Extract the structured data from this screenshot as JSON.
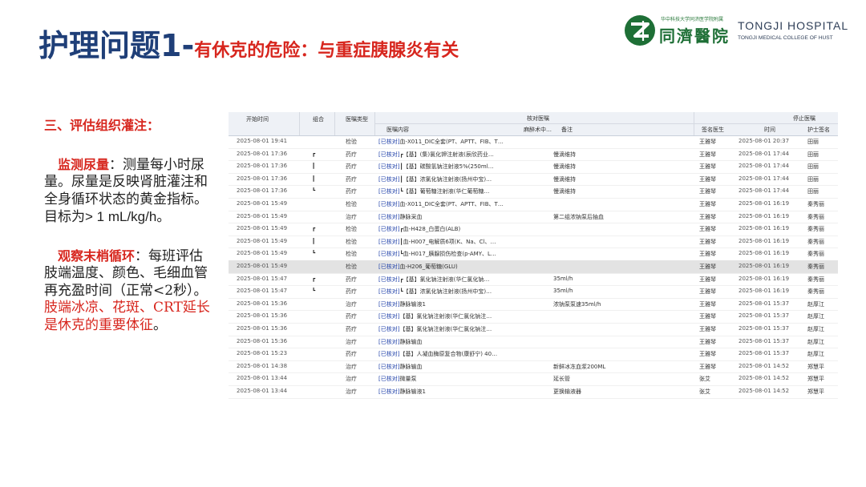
{
  "title": {
    "main": "护理问题1-",
    "sub": "有休克的危险：与重症胰腺炎有关"
  },
  "logo": {
    "small_text": "华中科技大学同济医学院附属",
    "cn_name": "同濟醫院",
    "en_name": "TONGJI HOSPITAL",
    "en_sub": "TONGJI MEDICAL COLLEGE OF HUST",
    "color": "#1e6f36"
  },
  "content": {
    "section_heading": "三、评估组织灌注：",
    "p1": {
      "keyword": "监测尿量",
      "text": "：测量每小时尿量。尿量是反映肾脏灌注和全身循环状态的黄金指标。目标为",
      "target": "> 1 mL/kg/h",
      "end": "。"
    },
    "p2": {
      "keyword": "观察末梢循环",
      "text": "：每班评估肢端温度、颜色、毛细血管再充盈时间（正常<2秒）。",
      "red_text": "肢端冰凉、花斑、CRT延长是休克的重要体征",
      "end": "。"
    }
  },
  "table": {
    "header": {
      "start_time": "开始时间",
      "group": "组合",
      "order_type": "医嘱类型",
      "verify_group": "核对医嘱",
      "order_content": "医嘱内容",
      "anesthesia": "麻醉术中…",
      "note": "备注",
      "stop_group": "停止医嘱",
      "signing_doctor": "签名医生",
      "time": "时间",
      "nurse_sign": "护士签名"
    },
    "rows": [
      {
        "start": "2025-08-01 19:41",
        "grp": "",
        "type": "检验",
        "tag": "[已核对]",
        "content": "血-X011_DIC全套(PT、APTT、FIB、T…",
        "note": "",
        "doctor": "王雅琴",
        "stop": "2025-08-01 20:37",
        "nurse": "田丽",
        "selected": false
      },
      {
        "start": "2025-08-01 17:36",
        "grp": "┏",
        "type": "药疗",
        "tag": "[已核对]",
        "content": "┏【基】(集)氯化钾注射液(辰欣药业…",
        "note": "慢滴维持",
        "doctor": "王雅琴",
        "stop": "2025-08-01 17:44",
        "nurse": "田丽",
        "selected": false
      },
      {
        "start": "2025-08-01 17:36",
        "grp": "┃",
        "type": "药疗",
        "tag": "[已核对]",
        "content": "┃【基】碳酸氢钠注射液5%(250ml…",
        "note": "慢滴维持",
        "doctor": "王雅琴",
        "stop": "2025-08-01 17:44",
        "nurse": "田丽",
        "selected": false
      },
      {
        "start": "2025-08-01 17:36",
        "grp": "┃",
        "type": "药疗",
        "tag": "[已核对]",
        "content": "┃【基】浓氯化钠注射液(扬州中宝)…",
        "note": "慢滴维持",
        "doctor": "王雅琴",
        "stop": "2025-08-01 17:44",
        "nurse": "田丽",
        "selected": false
      },
      {
        "start": "2025-08-01 17:36",
        "grp": "┗",
        "type": "药疗",
        "tag": "[已核对]",
        "content": "┗【基】葡萄糖注射液(华仁葡萄糖…",
        "note": "慢滴维持",
        "doctor": "王雅琴",
        "stop": "2025-08-01 17:44",
        "nurse": "田丽",
        "selected": false
      },
      {
        "start": "2025-08-01 15:49",
        "grp": "",
        "type": "检验",
        "tag": "[已核对]",
        "content": "血-X011_DIC全套(PT、APTT、FIB、T…",
        "note": "",
        "doctor": "王雅琴",
        "stop": "2025-08-01 16:19",
        "nurse": "秦秀丽",
        "selected": false
      },
      {
        "start": "2025-08-01 15:49",
        "grp": "",
        "type": "治疗",
        "tag": "[已核对]",
        "content": "静脉采血",
        "note": "第二组浓钠泵后抽血",
        "doctor": "王雅琴",
        "stop": "2025-08-01 16:19",
        "nurse": "秦秀丽",
        "selected": false
      },
      {
        "start": "2025-08-01 15:49",
        "grp": "┏",
        "type": "检验",
        "tag": "[已核对]",
        "content": "┏血-H428_白蛋白(ALB)",
        "note": "",
        "doctor": "王雅琴",
        "stop": "2025-08-01 16:19",
        "nurse": "秦秀丽",
        "selected": false
      },
      {
        "start": "2025-08-01 15:49",
        "grp": "┃",
        "type": "检验",
        "tag": "[已核对]",
        "content": "┃血-H007_电解质6项(K、Na、Cl、…",
        "note": "",
        "doctor": "王雅琴",
        "stop": "2025-08-01 16:19",
        "nurse": "秦秀丽",
        "selected": false
      },
      {
        "start": "2025-08-01 15:49",
        "grp": "┗",
        "type": "检验",
        "tag": "[已核对]",
        "content": "┗血-H017_胰腺损伤检查(p-AMY、L…",
        "note": "",
        "doctor": "王雅琴",
        "stop": "2025-08-01 16:19",
        "nurse": "秦秀丽",
        "selected": false
      },
      {
        "start": "2025-08-01 15:49",
        "grp": "",
        "type": "检验",
        "tag": "[已核对]",
        "content": "血-H206_葡萄糖(GLU)",
        "note": "",
        "doctor": "王雅琴",
        "stop": "2025-08-01 16:19",
        "nurse": "秦秀丽",
        "selected": true
      },
      {
        "start": "2025-08-01 15:47",
        "grp": "┏",
        "type": "药疗",
        "tag": "[已核对]",
        "content": "┏【基】氯化钠注射液(华仁氯化钠…",
        "note": "35ml/h",
        "doctor": "王雅琴",
        "stop": "2025-08-01 16:19",
        "nurse": "秦秀丽",
        "selected": false
      },
      {
        "start": "2025-08-01 15:47",
        "grp": "┗",
        "type": "药疗",
        "tag": "[已核对]",
        "content": "┗【基】浓氯化钠注射液(扬州中宝)…",
        "note": "35ml/h",
        "doctor": "王雅琴",
        "stop": "2025-08-01 16:19",
        "nurse": "秦秀丽",
        "selected": false
      },
      {
        "start": "2025-08-01 15:36",
        "grp": "",
        "type": "治疗",
        "tag": "[已核对]",
        "content": "静脉输液1",
        "note": "浓钠泵泵速35ml/h",
        "doctor": "王雅琴",
        "stop": "2025-08-01 15:37",
        "nurse": "赵厚江",
        "selected": false
      },
      {
        "start": "2025-08-01 15:36",
        "grp": "",
        "type": "药疗",
        "tag": "[已核对]",
        "content": "【基】氯化钠注射液(华仁氯化钠注…",
        "note": "",
        "doctor": "王雅琴",
        "stop": "2025-08-01 15:37",
        "nurse": "赵厚江",
        "selected": false
      },
      {
        "start": "2025-08-01 15:36",
        "grp": "",
        "type": "药疗",
        "tag": "[已核对]",
        "content": "【基】氯化钠注射液(华仁氯化钠注…",
        "note": "",
        "doctor": "王雅琴",
        "stop": "2025-08-01 15:37",
        "nurse": "赵厚江",
        "selected": false
      },
      {
        "start": "2025-08-01 15:36",
        "grp": "",
        "type": "治疗",
        "tag": "[已核对]",
        "content": "静脉输血",
        "note": "",
        "doctor": "王雅琴",
        "stop": "2025-08-01 15:37",
        "nurse": "赵厚江",
        "selected": false
      },
      {
        "start": "2025-08-01 15:23",
        "grp": "",
        "type": "药疗",
        "tag": "[已核对]",
        "content": "【基】人凝血酶原复合物(康舒宁) 40…",
        "note": "",
        "doctor": "王雅琴",
        "stop": "2025-08-01 15:37",
        "nurse": "赵厚江",
        "selected": false
      },
      {
        "start": "2025-08-01 14:38",
        "grp": "",
        "type": "治疗",
        "tag": "[已核对]",
        "content": "静脉输血",
        "note": "新鲜冰冻血浆200ML",
        "doctor": "王雅琴",
        "stop": "2025-08-01 14:52",
        "nurse": "郑慧平",
        "selected": false
      },
      {
        "start": "2025-08-01 13:44",
        "grp": "",
        "type": "治疗",
        "tag": "[已核对]",
        "content": "微量泵",
        "note": "延长管",
        "doctor": "张艾",
        "stop": "2025-08-01 14:52",
        "nurse": "郑慧平",
        "selected": false
      },
      {
        "start": "2025-08-01 13:44",
        "grp": "",
        "type": "治疗",
        "tag": "[已核对]",
        "content": "静脉输液1",
        "note": "更换输液器",
        "doctor": "张艾",
        "stop": "2025-08-01 14:52",
        "nurse": "郑慧平",
        "selected": false
      }
    ]
  }
}
